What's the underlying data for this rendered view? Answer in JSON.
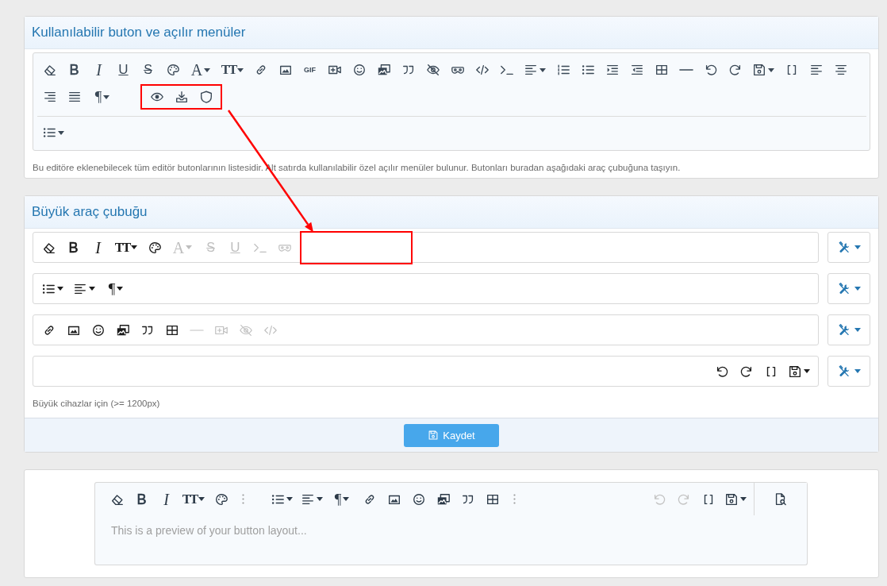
{
  "available": {
    "title": "Kullanılabilir buton ve açılır menüler",
    "rows": [
      [
        {
          "kind": "eraser"
        },
        {
          "kind": "bold",
          "label": "B"
        },
        {
          "kind": "italic",
          "label": "I"
        },
        {
          "kind": "underline",
          "label": "U"
        },
        {
          "kind": "strike",
          "label": "S"
        },
        {
          "kind": "palette"
        },
        {
          "kind": "font",
          "label": "A",
          "menu": true
        },
        {
          "kind": "size",
          "label": "TT",
          "menu": true
        },
        {
          "kind": "link"
        },
        {
          "kind": "image"
        },
        {
          "kind": "gif",
          "label": "GIF"
        },
        {
          "kind": "video"
        },
        {
          "kind": "smiley"
        },
        {
          "kind": "gallery"
        },
        {
          "kind": "quote"
        },
        {
          "kind": "eye-slash"
        },
        {
          "kind": "mask"
        },
        {
          "kind": "code"
        },
        {
          "kind": "terminal"
        },
        {
          "kind": "align-lines",
          "menu": true
        },
        {
          "kind": "numbered-list"
        },
        {
          "kind": "bullet-list"
        },
        {
          "kind": "indent"
        },
        {
          "kind": "outdent"
        },
        {
          "kind": "table"
        },
        {
          "kind": "line"
        },
        {
          "kind": "undo"
        },
        {
          "kind": "redo"
        },
        {
          "kind": "floppy",
          "menu": true
        },
        {
          "kind": "brackets"
        },
        {
          "kind": "align-left"
        },
        {
          "kind": "align-center"
        }
      ],
      [
        {
          "kind": "align-right"
        },
        {
          "kind": "justify"
        },
        {
          "kind": "para",
          "label": "¶",
          "menu": true
        },
        {
          "kind": "group",
          "highlighted": true,
          "items": [
            {
              "kind": "eye"
            },
            {
              "kind": "download"
            },
            {
              "kind": "shield"
            }
          ]
        }
      ]
    ],
    "menus": [
      {
        "kind": "bullet-list",
        "menu": true
      }
    ],
    "description": "Bu editöre eklenebilecek tüm editör butonlarının listesidir. Alt satırda kullanılabilir özel açılır menüler bulunur. Butonları buradan aşağıdaki araç çubuğuna taşıyın."
  },
  "toolbar": {
    "title": "Büyük araç çubuğu",
    "rows": [
      {
        "items": [
          {
            "kind": "eraser",
            "disabled": false
          },
          {
            "kind": "bold",
            "label": "B",
            "disabled": false
          },
          {
            "kind": "italic",
            "label": "I",
            "disabled": false
          },
          {
            "kind": "size",
            "label": "TT",
            "menu": true,
            "disabled": false
          },
          {
            "kind": "palette",
            "disabled": false
          },
          {
            "kind": "font",
            "label": "A",
            "menu": true,
            "disabled": true
          },
          {
            "kind": "strike",
            "label": "S",
            "disabled": true
          },
          {
            "kind": "underline",
            "label": "U",
            "disabled": true
          },
          {
            "kind": "terminal",
            "disabled": true
          },
          {
            "kind": "mask",
            "disabled": true
          },
          {
            "kind": "slot",
            "highlighted": true
          }
        ]
      },
      {
        "items": [
          {
            "kind": "bullet-list",
            "menu": true,
            "disabled": false
          },
          {
            "kind": "align-lines",
            "menu": true,
            "disabled": false
          },
          {
            "kind": "para",
            "label": "¶",
            "menu": true,
            "disabled": false
          }
        ]
      },
      {
        "items": [
          {
            "kind": "link",
            "disabled": false
          },
          {
            "kind": "image",
            "disabled": false
          },
          {
            "kind": "smiley",
            "disabled": false
          },
          {
            "kind": "gallery",
            "disabled": false
          },
          {
            "kind": "quote",
            "disabled": false
          },
          {
            "kind": "table",
            "disabled": false
          },
          {
            "kind": "line",
            "disabled": true
          },
          {
            "kind": "video",
            "disabled": true
          },
          {
            "kind": "eye-slash",
            "disabled": true
          },
          {
            "kind": "code",
            "disabled": true
          }
        ]
      },
      {
        "end_items": [
          {
            "kind": "undo",
            "disabled": false
          },
          {
            "kind": "redo",
            "disabled": false
          },
          {
            "kind": "brackets",
            "disabled": false
          },
          {
            "kind": "floppy",
            "menu": true,
            "disabled": false
          }
        ]
      }
    ],
    "description": "Büyük cihazlar için (>= 1200px)",
    "save_button": "Kaydet"
  },
  "annotation": {
    "kind": "arrow"
  },
  "preview": {
    "left": [
      {
        "kind": "eraser",
        "disabled": false
      },
      {
        "kind": "bold",
        "label": "B",
        "disabled": false
      },
      {
        "kind": "italic",
        "label": "I",
        "disabled": false
      },
      {
        "kind": "size",
        "label": "TT",
        "menu": true,
        "disabled": false
      },
      {
        "kind": "palette",
        "disabled": false
      },
      {
        "kind": "more",
        "disabled": false
      },
      {
        "kind": "bullet-list",
        "menu": true,
        "disabled": false
      },
      {
        "kind": "align-lines",
        "menu": true,
        "disabled": false
      },
      {
        "kind": "para",
        "label": "¶",
        "menu": true,
        "disabled": false
      },
      {
        "kind": "link",
        "disabled": false
      },
      {
        "kind": "image",
        "disabled": false
      },
      {
        "kind": "smiley",
        "disabled": false
      },
      {
        "kind": "gallery",
        "disabled": false
      },
      {
        "kind": "quote",
        "disabled": false
      },
      {
        "kind": "table",
        "disabled": false
      },
      {
        "kind": "more",
        "disabled": false
      }
    ],
    "right": [
      {
        "kind": "undo",
        "disabled": true
      },
      {
        "kind": "redo",
        "disabled": true
      },
      {
        "kind": "brackets",
        "disabled": false
      },
      {
        "kind": "floppy",
        "menu": true,
        "disabled": false
      }
    ],
    "preview_button": {
      "kind": "doc-search"
    },
    "placeholder": "This is a preview of your button layout..."
  }
}
